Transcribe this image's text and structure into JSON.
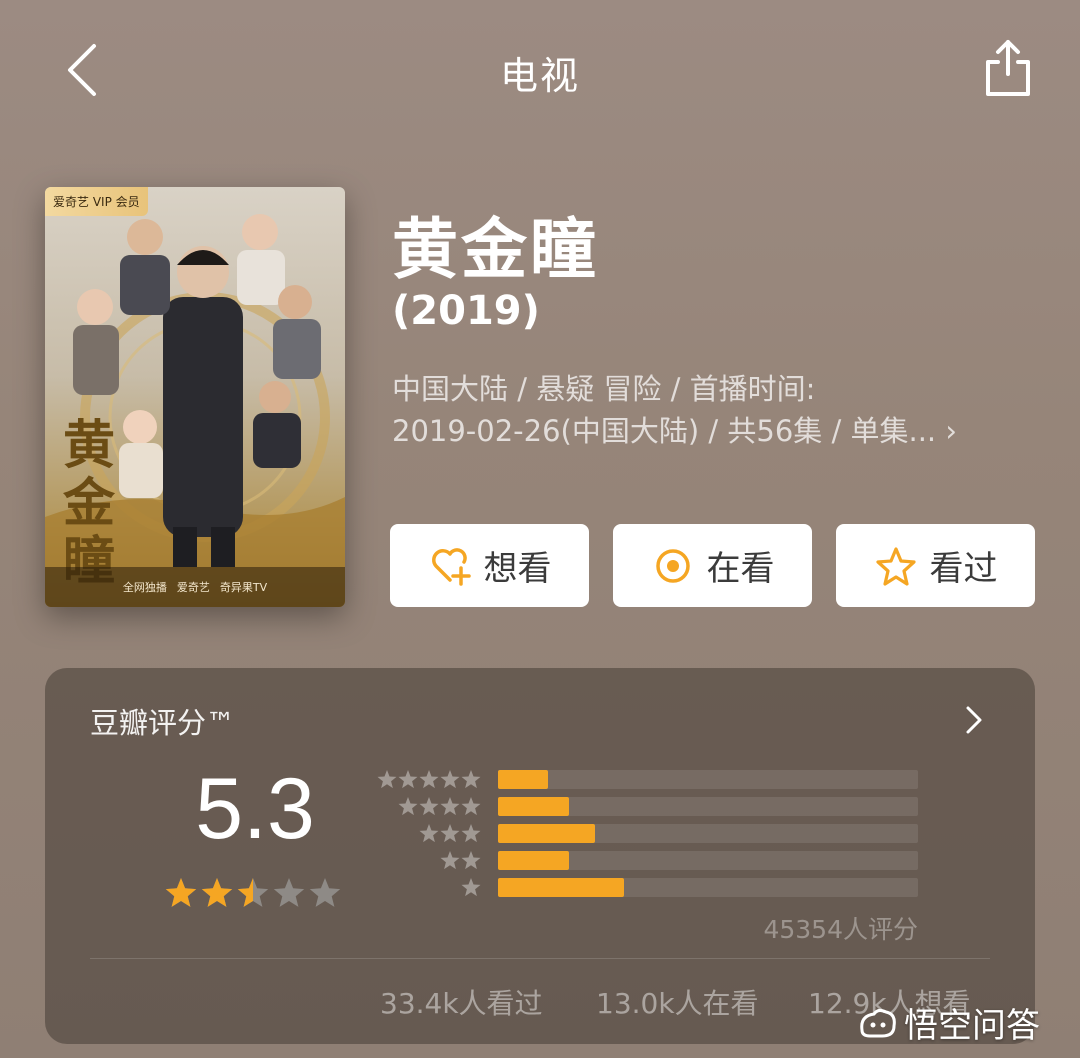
{
  "header": {
    "title": "电视"
  },
  "poster": {
    "badge": "爱奇艺 VIP 会员",
    "title_art": "黄金瞳",
    "footer_left": "全网独播",
    "footer_brand1": "爱奇艺",
    "footer_brand2": "奇异果TV"
  },
  "show": {
    "title": "黄金瞳",
    "year": "(2019)",
    "meta_line1": "中国大陆 / 悬疑 冒险 / 首播时间:",
    "meta_line2": "2019-02-26(中国大陆) / 共56集 / 单集...",
    "meta_chevron": "›"
  },
  "actions": [
    {
      "label": "想看",
      "icon": "heart-plus-icon"
    },
    {
      "label": "在看",
      "icon": "target-circle-icon"
    },
    {
      "label": "看过",
      "icon": "star-outline-icon"
    }
  ],
  "rating": {
    "label": "豆瓣评分™",
    "score": "5.3",
    "score_value": 5.3,
    "stars_filled": 2.5,
    "count": "45354人评分",
    "distribution": [
      {
        "stars": 5,
        "fraction": 0.12
      },
      {
        "stars": 4,
        "fraction": 0.17
      },
      {
        "stars": 3,
        "fraction": 0.23
      },
      {
        "stars": 2,
        "fraction": 0.17
      },
      {
        "stars": 1,
        "fraction": 0.3
      }
    ],
    "bar_color": "#f5a623"
  },
  "stats": {
    "watched": "33.4k人看过",
    "watching": "13.0k人在看",
    "want": "12.9k人想看"
  },
  "watermark": {
    "text": "悟空问答"
  },
  "colors": {
    "accent": "#f5a623",
    "star_empty": "#8e8a86"
  }
}
